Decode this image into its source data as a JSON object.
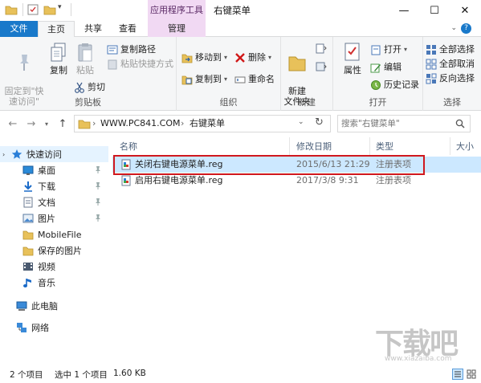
{
  "window": {
    "title": "右键菜单",
    "context_tab": "应用程序工具",
    "minimize": "—",
    "maximize": "☐",
    "close": "✕"
  },
  "ribbon_tabs": [
    "文件",
    "主页",
    "共享",
    "查看",
    "管理"
  ],
  "help": "?",
  "ribbon": {
    "clipboard": {
      "label": "剪贴板",
      "pin": "固定到\"快\n速访问\"",
      "copy": "复制",
      "paste": "粘贴",
      "copy_path": "复制路径",
      "paste_shortcut": "粘贴快捷方式",
      "cut": "剪切"
    },
    "organize": {
      "label": "组织",
      "move_to": "移动到",
      "copy_to": "复制到",
      "delete": "删除",
      "rename": "重命名"
    },
    "new": {
      "label": "新建",
      "new_folder": "新建\n文件夹"
    },
    "open": {
      "label": "打开",
      "properties": "属性",
      "open": "打开",
      "edit": "编辑",
      "history": "历史记录"
    },
    "select": {
      "label": "选择",
      "select_all": "全部选择",
      "select_none": "全部取消",
      "invert": "反向选择"
    }
  },
  "address": {
    "crumbs": [
      "WWW.PC841.COM",
      "右键菜单"
    ],
    "separator": "›"
  },
  "search": {
    "placeholder": "搜索\"右键菜单\""
  },
  "nav": {
    "quick_access": "快速访问",
    "items": [
      "桌面",
      "下载",
      "文档",
      "图片",
      "MobileFile",
      "保存的图片",
      "视频",
      "音乐"
    ],
    "this_pc": "此电脑",
    "network": "网络"
  },
  "columns": [
    "名称",
    "修改日期",
    "类型",
    "大小"
  ],
  "files": [
    {
      "name": "关闭右键电源菜单.reg",
      "date": "2015/6/13 21:29",
      "type": "注册表项"
    },
    {
      "name": "启用右键电源菜单.reg",
      "date": "2017/3/8 9:31",
      "type": "注册表项"
    }
  ],
  "status": {
    "count": "2 个项目",
    "selected": "选中 1 个项目",
    "size": "1.60 KB"
  },
  "watermark": {
    "big": "下载吧",
    "url": "www.xiazaiba.com"
  },
  "colors": {
    "accent": "#1979ca",
    "context_tab": "#f1d9f3",
    "selection": "#cce8ff",
    "highlight_box": "#d0181e"
  }
}
